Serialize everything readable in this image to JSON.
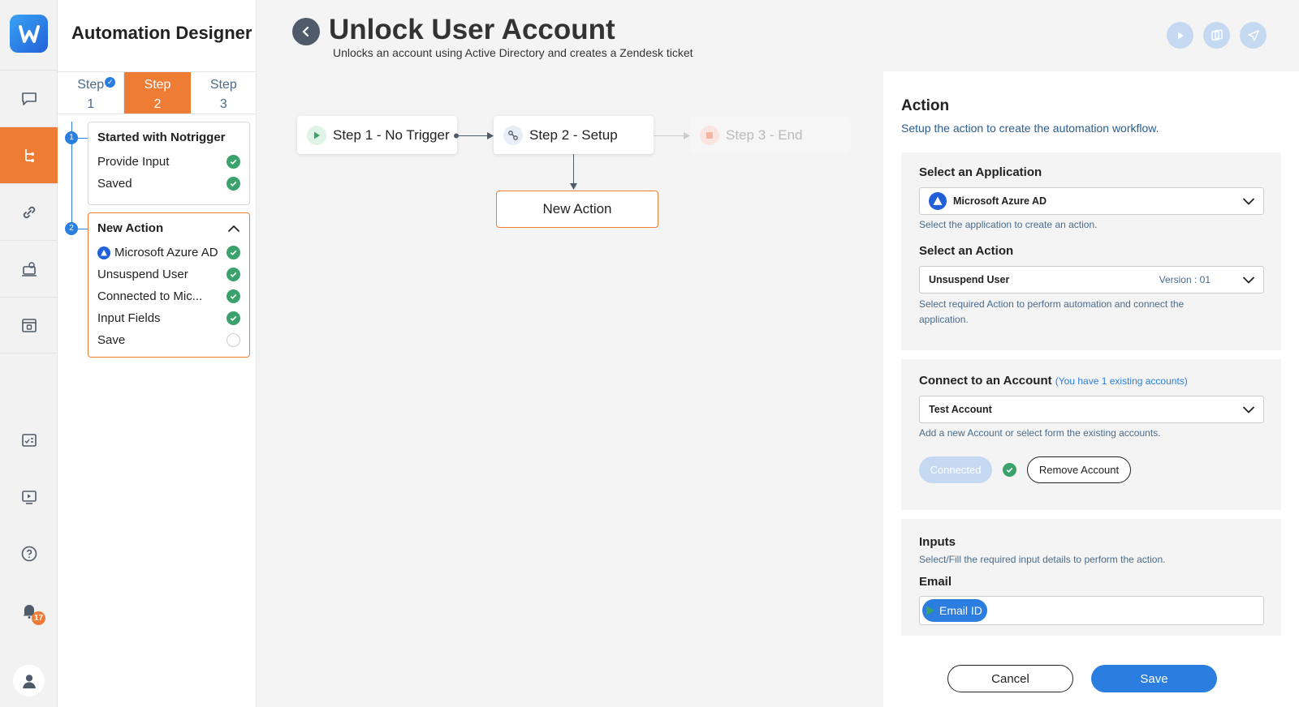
{
  "sidebar": {
    "notification_count": "17"
  },
  "steps_panel": {
    "title": "Automation Designer",
    "tabs": [
      {
        "word": "Step",
        "num": "1"
      },
      {
        "word": "Step",
        "num": "2"
      },
      {
        "word": "Step",
        "num": "3"
      }
    ],
    "timeline": [
      "1",
      "2"
    ],
    "card1": {
      "title": "Started with Notrigger",
      "rows": [
        "Provide Input",
        "Saved"
      ]
    },
    "card2": {
      "title": "New Action",
      "rows": [
        "Microsoft Azure AD",
        "Unsuspend User",
        "Connected to Mic...",
        "Input Fields",
        "Save"
      ]
    }
  },
  "header": {
    "title": "Unlock User Account",
    "subtitle": "Unlocks an account using Active Directory and creates a Zendesk ticket"
  },
  "flow": {
    "node1": "Step 1 - No Trigger",
    "node2": "Step 2 - Setup",
    "node3": "Step 3 - End",
    "new_action": "New Action"
  },
  "action_panel": {
    "title": "Action",
    "subtitle": "Setup the action to create the automation workflow.",
    "application": {
      "label": "Select an Application",
      "value": "Microsoft Azure AD",
      "help": "Select the application to create an action."
    },
    "action": {
      "label": "Select an Action",
      "value": "Unsuspend User",
      "version": "Version : 01",
      "help": "Select required Action to perform automation and connect the application."
    },
    "account": {
      "label": "Connect to an Account",
      "hint": "(You have 1 existing accounts)",
      "value": "Test Account",
      "help": "Add a new Account or select form the existing accounts.",
      "connected_label": "Connected",
      "remove_label": "Remove Account"
    },
    "inputs": {
      "label": "Inputs",
      "help": "Select/Fill the required input details to perform the action.",
      "email_label": "Email",
      "email_chip": "Email ID"
    },
    "cancel_label": "Cancel",
    "save_label": "Save"
  },
  "colors": {
    "accent": "#ef7c35",
    "primary": "#2b7de0",
    "success": "#3aa26a"
  }
}
